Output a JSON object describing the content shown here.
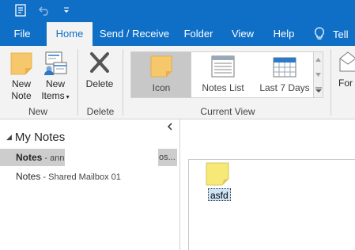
{
  "titlebar": {
    "icons": [
      "app-icon",
      "undo-icon",
      "customize-dropdown-icon"
    ]
  },
  "tabs": [
    {
      "label": "File",
      "active": false
    },
    {
      "label": "Home",
      "active": true
    },
    {
      "label": "Send / Receive",
      "active": false
    },
    {
      "label": "Folder",
      "active": false
    },
    {
      "label": "View",
      "active": false
    },
    {
      "label": "Help",
      "active": false
    }
  ],
  "tell_me": {
    "label": "Tell",
    "icon": "lightbulb-icon"
  },
  "ribbon": {
    "new_group": {
      "label": "New",
      "new_note": {
        "line1": "New",
        "line2": "Note"
      },
      "new_items": {
        "line1": "New",
        "line2": "Items"
      }
    },
    "delete_group": {
      "label": "Delete",
      "delete_button": "Delete"
    },
    "view_group": {
      "label": "Current View",
      "items": [
        {
          "label": "Icon",
          "selected": true
        },
        {
          "label": "Notes List",
          "selected": false
        },
        {
          "label": "Last 7 Days",
          "selected": false
        }
      ]
    },
    "forward_partial": "For"
  },
  "nav": {
    "root": "My Notes",
    "folders": [
      {
        "name": "Notes",
        "sub": " - ann",
        "tail": "os...",
        "selected": true
      },
      {
        "name": "Notes",
        "sub": " - Shared Mailbox 01",
        "tail": "",
        "selected": false
      }
    ]
  },
  "notes": [
    {
      "title": "asfd",
      "color": "#f7e978"
    }
  ],
  "colors": {
    "accent": "#0f6fc6",
    "ribbon_bg": "#f3f3f3",
    "note_yellow": "#f7e978",
    "selection": "#cdcdcd"
  }
}
